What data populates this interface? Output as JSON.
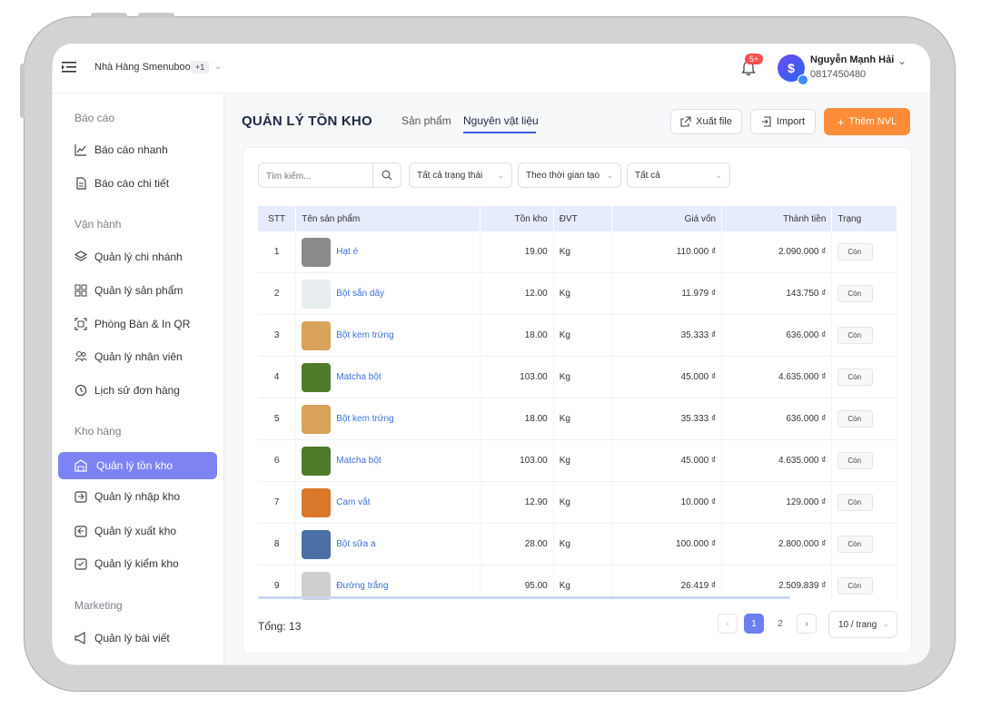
{
  "header": {
    "store_name": "Nhà Hàng Smenubook",
    "store_extra": "+1",
    "notification_badge": "5+",
    "user_name": "Nguyễn Mạnh Hải",
    "user_phone": "0817450480"
  },
  "sidebar": {
    "sections": [
      {
        "title": "Báo cáo"
      },
      {
        "title": "Vận hành"
      },
      {
        "title": "Kho hàng"
      },
      {
        "title": "Marketing"
      }
    ],
    "items": [
      {
        "label": "Báo cáo nhanh",
        "icon": "line-chart-icon"
      },
      {
        "label": "Báo cáo chi tiết",
        "icon": "document-icon"
      },
      {
        "label": "Quản lý chi nhánh",
        "icon": "layers-icon"
      },
      {
        "label": "Quản lý sản phẩm",
        "icon": "grid-icon"
      },
      {
        "label": "Phòng Bàn & In QR",
        "icon": "qr-icon"
      },
      {
        "label": "Quản lý nhân viên",
        "icon": "users-icon"
      },
      {
        "label": "Lịch sử đơn hàng",
        "icon": "history-icon"
      },
      {
        "label": "Quản lý tồn kho",
        "icon": "warehouse-icon",
        "active": true
      },
      {
        "label": "Quản lý nhập kho",
        "icon": "import-box-icon"
      },
      {
        "label": "Quản lý xuất kho",
        "icon": "export-box-icon"
      },
      {
        "label": "Quản lý kiểm kho",
        "icon": "check-box-icon"
      },
      {
        "label": "Quản lý bài viết",
        "icon": "megaphone-icon"
      }
    ]
  },
  "main": {
    "title": "QUẢN LÝ TỒN KHO",
    "tabs": [
      {
        "label": "Sản phẩm",
        "active": false
      },
      {
        "label": "Nguyên vật liệu",
        "active": true
      }
    ],
    "actions": {
      "export_label": "Xuất file",
      "import_label": "Import",
      "add_label": "Thêm NVL"
    },
    "filters": {
      "search_placeholder": "Tìm kiếm...",
      "status": "Tất cả trạng thái",
      "time": "Theo thời gian tạo",
      "all": "Tất cả"
    },
    "table": {
      "columns": [
        "STT",
        "Tên sản phẩm",
        "Tồn kho",
        "ĐVT",
        "Giá vốn",
        "Thành tiền",
        "Trạng"
      ],
      "rows": [
        {
          "stt": "1",
          "name": "Hạt é",
          "stock": "19.00",
          "unit": "Kg",
          "cost": "110.000 ₫",
          "total": "2.090.000 ₫",
          "status": "Còn",
          "thumb_color": "#8a8a8a"
        },
        {
          "stt": "2",
          "name": "Bột sắn dây",
          "stock": "12.00",
          "unit": "Kg",
          "cost": "11.979 ₫",
          "total": "143.750 ₫",
          "status": "Còn",
          "thumb_color": "#e8eef0"
        },
        {
          "stt": "3",
          "name": "Bột kem trứng",
          "stock": "18.00",
          "unit": "Kg",
          "cost": "35.333 ₫",
          "total": "636.000 ₫",
          "status": "Còn",
          "thumb_color": "#d9a35c"
        },
        {
          "stt": "4",
          "name": "Matcha bột",
          "stock": "103.00",
          "unit": "Kg",
          "cost": "45.000 ₫",
          "total": "4.635.000 ₫",
          "status": "Còn",
          "thumb_color": "#4f7a2a"
        },
        {
          "stt": "5",
          "name": "Bột kem trứng",
          "stock": "18.00",
          "unit": "Kg",
          "cost": "35.333 ₫",
          "total": "636.000 ₫",
          "status": "Còn",
          "thumb_color": "#d9a35c"
        },
        {
          "stt": "6",
          "name": "Matcha bột",
          "stock": "103.00",
          "unit": "Kg",
          "cost": "45.000 ₫",
          "total": "4.635.000 ₫",
          "status": "Còn",
          "thumb_color": "#4f7a2a"
        },
        {
          "stt": "7",
          "name": "Cam vắt",
          "stock": "12.90",
          "unit": "Kg",
          "cost": "10.000 ₫",
          "total": "129.000 ₫",
          "status": "Còn",
          "thumb_color": "#d9772b"
        },
        {
          "stt": "8",
          "name": "Bột sữa a",
          "stock": "28.00",
          "unit": "Kg",
          "cost": "100.000 ₫",
          "total": "2.800.000 ₫",
          "status": "Còn",
          "thumb_color": "#4a6fa5"
        },
        {
          "stt": "9",
          "name": "Đường trắng",
          "stock": "95.00",
          "unit": "Kg",
          "cost": "26.419 ₫",
          "total": "2.509.839 ₫",
          "status": "Còn",
          "thumb_color": "#cfcfcf"
        }
      ]
    },
    "footer": {
      "total": "Tổng: 13",
      "pages": [
        "1",
        "2"
      ],
      "current_page": "1",
      "page_size": "10 / trang"
    }
  },
  "colors": {
    "primary_button": "#ff8c38",
    "active_nav": "#7d83f2",
    "table_header": "#e6ecfb",
    "link": "#3b6fd8"
  }
}
